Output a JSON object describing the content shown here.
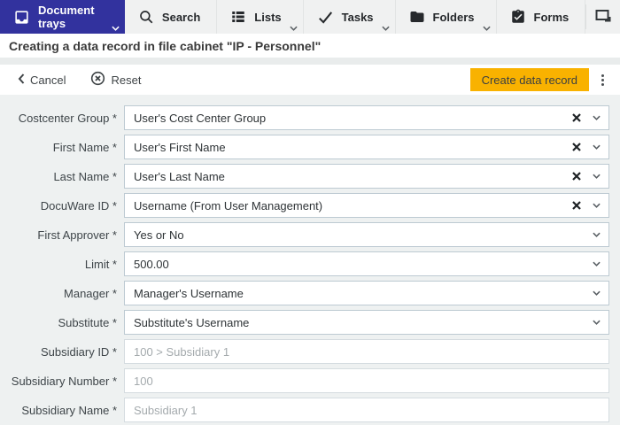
{
  "nav": {
    "active_color": "#32329e",
    "tabs": [
      {
        "label": "Document trays",
        "icon": "tray-icon",
        "active": true,
        "has_chevron": true
      },
      {
        "label": "Search",
        "icon": "search-icon",
        "active": false,
        "has_chevron": false
      },
      {
        "label": "Lists",
        "icon": "list-icon",
        "active": false,
        "has_chevron": true
      },
      {
        "label": "Tasks",
        "icon": "check-icon",
        "active": false,
        "has_chevron": true
      },
      {
        "label": "Folders",
        "icon": "folder-icon",
        "active": false,
        "has_chevron": true
      },
      {
        "label": "Forms",
        "icon": "clipboard-check-icon",
        "active": false,
        "has_chevron": false
      }
    ],
    "window_icon": "restore-window-icon"
  },
  "header": {
    "title": "Creating a data record in file cabinet \"IP - Personnel\""
  },
  "toolbar": {
    "cancel_label": "Cancel",
    "reset_label": "Reset",
    "create_label": "Create data record",
    "accent_color": "#f9b200",
    "kebab_icon": "kebab-menu-icon",
    "cancel_icon": "chevron-left-icon",
    "reset_icon": "reset-circle-x-icon"
  },
  "form": {
    "fields": [
      {
        "label": "Costcenter Group *",
        "value": "User's Cost Center Group",
        "clearable": true,
        "dropdown": true,
        "disabled": false
      },
      {
        "label": "First Name *",
        "value": "User's First Name",
        "clearable": true,
        "dropdown": true,
        "disabled": false
      },
      {
        "label": "Last Name *",
        "value": "User's Last Name",
        "clearable": true,
        "dropdown": true,
        "disabled": false
      },
      {
        "label": "DocuWare ID *",
        "value": "Username (From User Management)",
        "clearable": true,
        "dropdown": true,
        "disabled": false
      },
      {
        "label": "First Approver *",
        "value": "Yes or No",
        "clearable": false,
        "dropdown": true,
        "disabled": false
      },
      {
        "label": "Limit *",
        "value": "500.00",
        "clearable": false,
        "dropdown": true,
        "disabled": false
      },
      {
        "label": "Manager *",
        "value": "Manager's Username",
        "clearable": false,
        "dropdown": true,
        "disabled": false
      },
      {
        "label": "Substitute *",
        "value": "Substitute's Username",
        "clearable": false,
        "dropdown": true,
        "disabled": false
      },
      {
        "label": "Subsidiary ID *",
        "value": "100 > Subsidiary 1",
        "clearable": false,
        "dropdown": false,
        "disabled": true
      },
      {
        "label": "Subsidiary Number *",
        "value": "100",
        "clearable": false,
        "dropdown": false,
        "disabled": true
      },
      {
        "label": "Subsidiary Name *",
        "value": "Subsidiary 1",
        "clearable": false,
        "dropdown": false,
        "disabled": true
      }
    ]
  }
}
